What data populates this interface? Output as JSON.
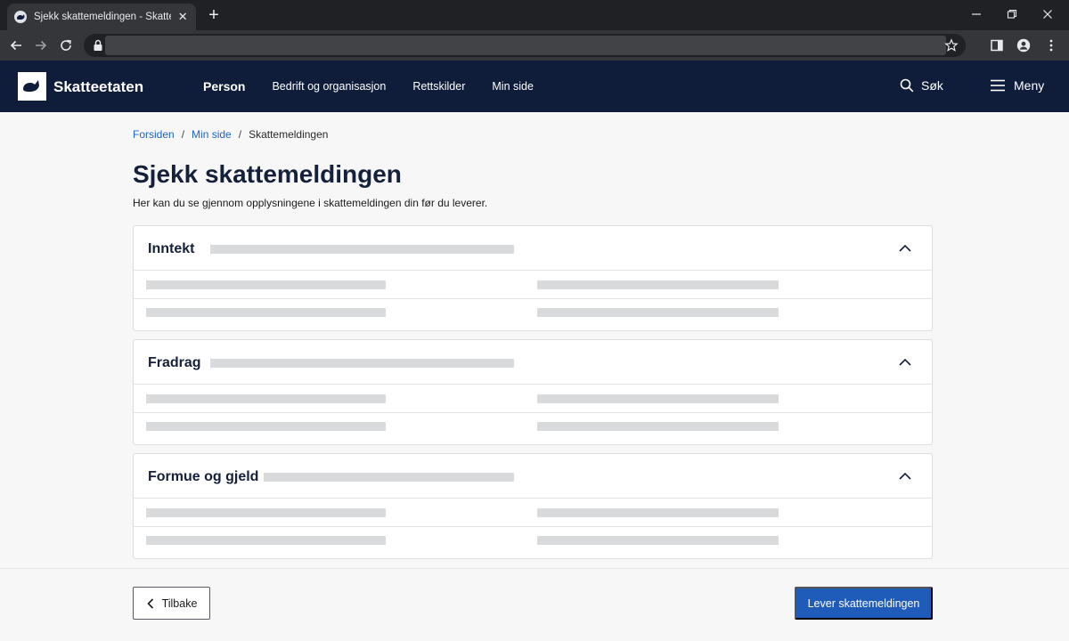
{
  "browser": {
    "tab_title": "Sjekk skattemeldingen - Skatteetaten",
    "tab_close": "✕",
    "new_tab": "+"
  },
  "site": {
    "brand": "Skatteetaten",
    "nav": [
      "Person",
      "Bedrift og organisasjon",
      "Rettskilder",
      "Min side"
    ],
    "search_label": "Søk",
    "menu_label": "Meny"
  },
  "breadcrumb": {
    "items": [
      "Forsiden",
      "Min side"
    ],
    "separator": "/",
    "current": "Skattemeldingen"
  },
  "page": {
    "title": "Sjekk skattemeldingen",
    "intro": "Her kan du se gjennom opplysningene i skattemeldingen din før du leverer."
  },
  "sections": [
    {
      "title": "Inntekt"
    },
    {
      "title": "Fradrag"
    },
    {
      "title": "Formue og gjeld"
    }
  ],
  "footer": {
    "back_label": "Tilbake",
    "submit_label": "Lever skattemeldingen"
  },
  "colors": {
    "header_bg": "#0f1d3a",
    "link": "#1f63c6",
    "primary_button": "#1f5bb8",
    "page_bg": "#f7f7f8"
  },
  "icons": {
    "search": "search-icon",
    "menu": "menu-icon",
    "chevron": "chevron-up-icon",
    "back": "chevron-left-icon"
  }
}
